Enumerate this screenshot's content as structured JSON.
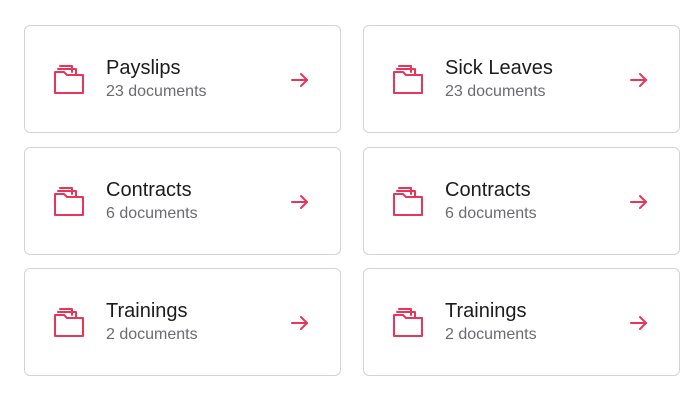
{
  "accent_color": "#e8355a",
  "cards": [
    {
      "title": "Payslips",
      "count": "23 documents",
      "icon": "folder-icon",
      "action_icon": "arrow-right-icon"
    },
    {
      "title": "Sick Leaves",
      "count": "23 documents",
      "icon": "folder-icon",
      "action_icon": "arrow-right-icon"
    },
    {
      "title": "Contracts",
      "count": "6 documents",
      "icon": "folder-icon",
      "action_icon": "arrow-right-icon"
    },
    {
      "title": "Contracts",
      "count": "6 documents",
      "icon": "folder-icon",
      "action_icon": "arrow-right-icon"
    },
    {
      "title": "Trainings",
      "count": "2 documents",
      "icon": "folder-icon",
      "action_icon": "arrow-right-icon"
    },
    {
      "title": "Trainings",
      "count": "2 documents",
      "icon": "folder-icon",
      "action_icon": "arrow-right-icon"
    }
  ]
}
